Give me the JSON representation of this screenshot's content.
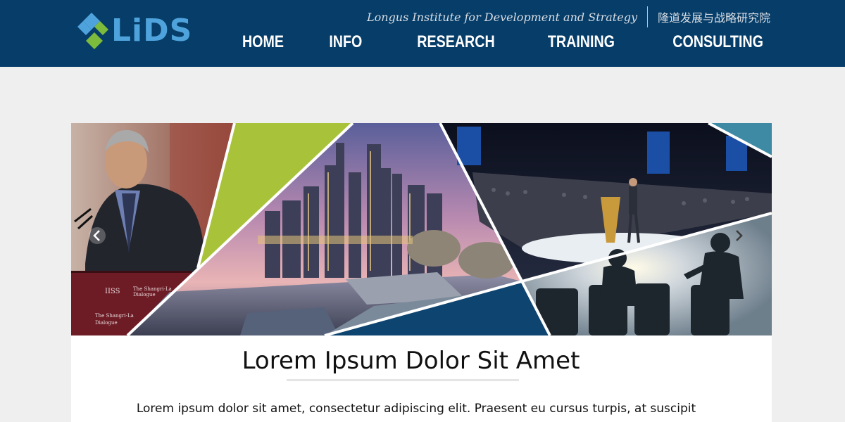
{
  "brand": {
    "logo_text": "LiDS",
    "tagline_en": "Longus Institute for Development and Strategy",
    "tagline_cn": "隆道发展与战略研究院"
  },
  "nav": {
    "items": [
      {
        "label": "HOME"
      },
      {
        "label": "INFO"
      },
      {
        "label": "RESEARCH"
      },
      {
        "label": "TRAINING"
      },
      {
        "label": "CONSULTING"
      }
    ]
  },
  "hero": {
    "podium_text_1": "IISS",
    "podium_text_2": "The Shangri-La\nDialogue",
    "podium_text_3": "The Shangri-La\nDialogue"
  },
  "article": {
    "headline": "Lorem Ipsum Dolor Sit Amet",
    "body": "Lorem ipsum dolor sit amet, consectetur adipiscing elit. Praesent eu cursus turpis, at suscipit"
  },
  "colors": {
    "header_bg": "#063d69",
    "logo_blue": "#4fa3dc",
    "logo_green": "#7dbb3c",
    "accent_green": "#a8c23a",
    "accent_navy": "#0e4470"
  }
}
